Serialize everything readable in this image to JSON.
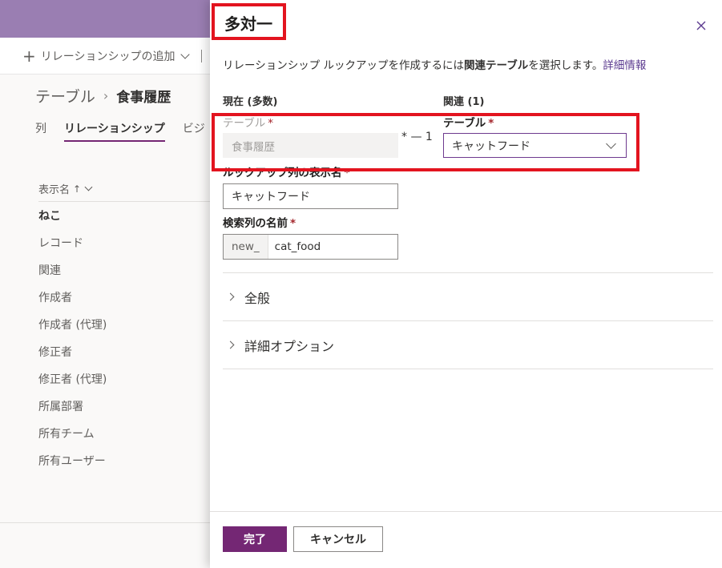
{
  "background": {
    "command_bar": {
      "add_relationship_label": "リレーションシップの追加"
    },
    "breadcrumb": {
      "parent": "テーブル",
      "separator": "›",
      "current": "食事履歴"
    },
    "tabs": [
      {
        "label": "列"
      },
      {
        "label": "リレーションシップ"
      },
      {
        "label": "ビジ"
      }
    ],
    "list": {
      "column_header": "表示名",
      "sort_indicator": "↑",
      "rows": [
        "ねこ",
        "レコード",
        "関連",
        "作成者",
        "作成者 (代理)",
        "修正者",
        "修正者 (代理)",
        "所属部署",
        "所有チーム",
        "所有ユーザー"
      ]
    }
  },
  "panel": {
    "title": "多対一",
    "close_icon": "close-icon",
    "description_prefix": "リレーションシップ ルックアップを作成するには",
    "description_bold": "関連テーブル",
    "description_suffix": "を選択します。",
    "learn_more_link": "詳細情報",
    "current_header": "現在 (多数)",
    "related_header": "関連 (1)",
    "current_table_label": "テーブル",
    "current_table_value": "食事履歴",
    "relation_symbol": "* — 1",
    "related_table_label": "テーブル",
    "related_table_value": "キャットフード",
    "lookup_display_label": "ルックアップ列の表示名",
    "lookup_display_value": "キャットフード",
    "lookup_name_label": "検索列の名前",
    "lookup_name_prefix": "new_",
    "lookup_name_value": "cat_food",
    "required_marker": "*",
    "sections": [
      {
        "label": "全般"
      },
      {
        "label": "詳細オプション"
      }
    ],
    "buttons": {
      "done": "完了",
      "cancel": "キャンセル"
    }
  },
  "colors": {
    "header_purple": "#9a7eb2",
    "primary_button": "#742774",
    "link": "#5b3a8f",
    "highlight_red": "#e3141f",
    "required_red": "#a4262c"
  }
}
